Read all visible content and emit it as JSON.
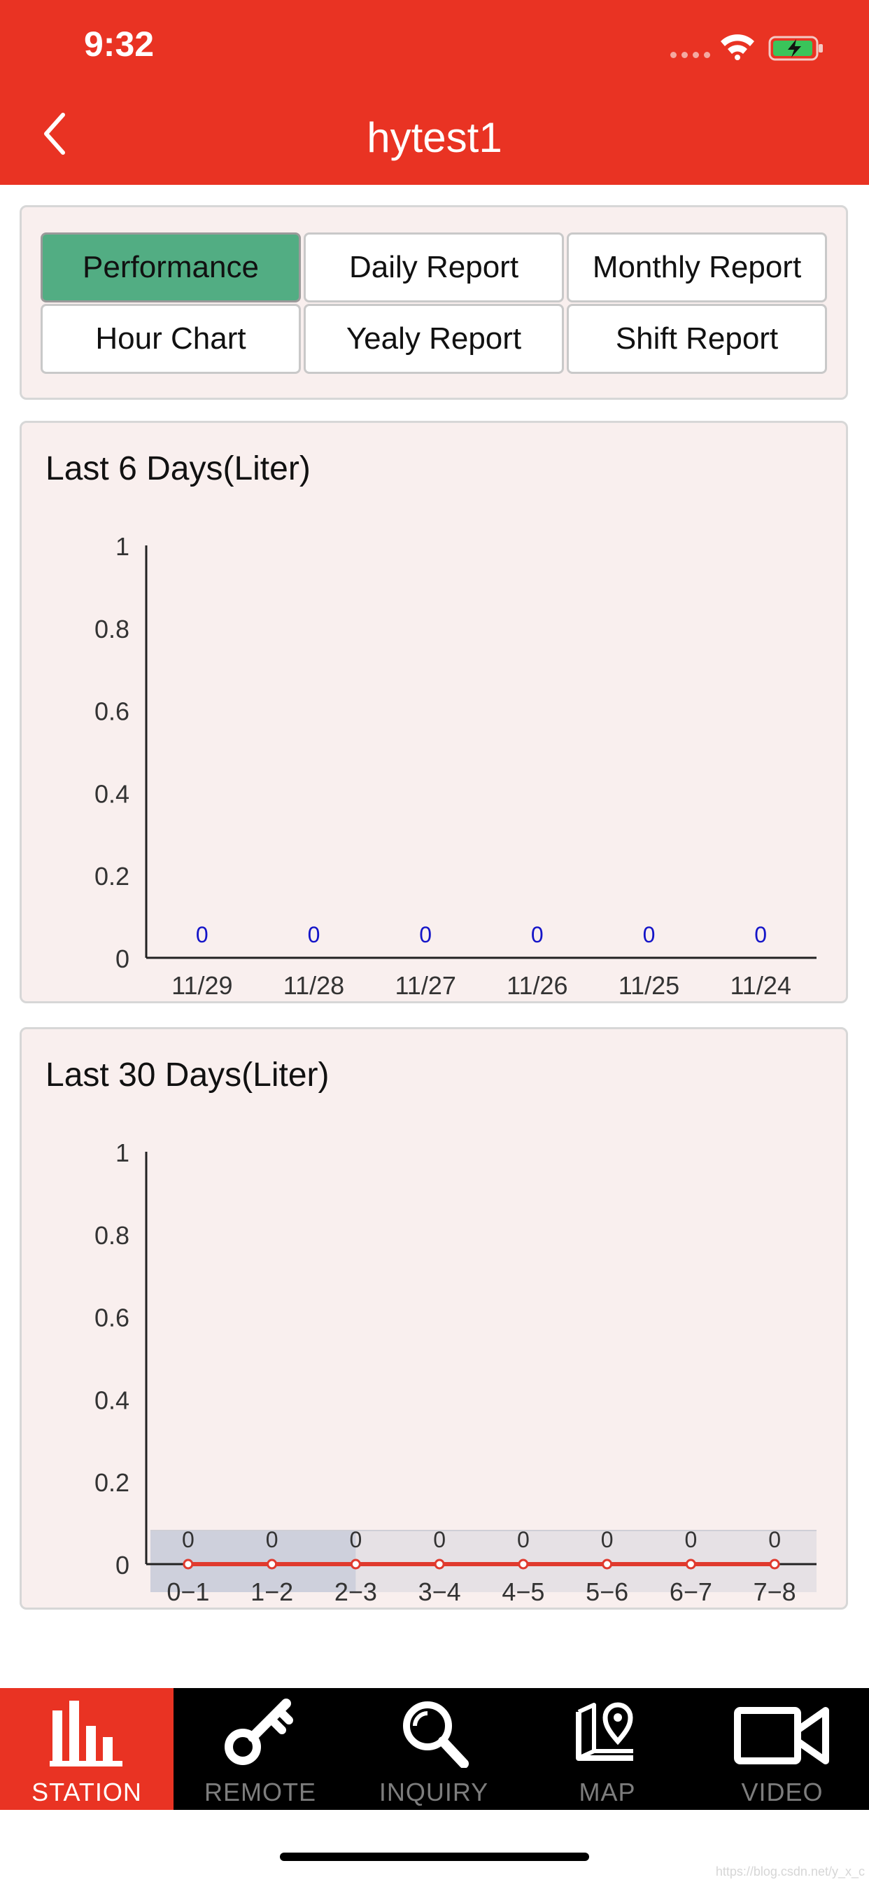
{
  "status_bar": {
    "time": "9:32"
  },
  "header": {
    "title": "hytest1"
  },
  "tabs": [
    {
      "label": "Performance",
      "active": true
    },
    {
      "label": "Daily Report",
      "active": false
    },
    {
      "label": "Monthly Report",
      "active": false
    },
    {
      "label": "Hour Chart",
      "active": false
    },
    {
      "label": "Yealy Report",
      "active": false
    },
    {
      "label": "Shift Report",
      "active": false
    }
  ],
  "chart_data": [
    {
      "type": "bar",
      "title": "Last 6 Days(Liter)",
      "categories": [
        "11/29",
        "11/28",
        "11/27",
        "11/26",
        "11/25",
        "11/24"
      ],
      "values": [
        0,
        0,
        0,
        0,
        0,
        0
      ],
      "value_labels": [
        "0",
        "0",
        "0",
        "0",
        "0",
        "0"
      ],
      "y_ticks": [
        "0",
        "0.2",
        "0.4",
        "0.6",
        "0.8",
        "1"
      ],
      "ylim": [
        0,
        1
      ],
      "grid": false,
      "label_color": "#1414c8"
    },
    {
      "type": "line",
      "title": "Last 30 Days(Liter)",
      "categories": [
        "0−1",
        "1−2",
        "2−3",
        "3−4",
        "4−5",
        "5−6",
        "6−7",
        "7−8"
      ],
      "values": [
        0,
        0,
        0,
        0,
        0,
        0,
        0,
        0
      ],
      "value_labels": [
        "0",
        "0",
        "0",
        "0",
        "0",
        "0",
        "0",
        "0"
      ],
      "y_ticks": [
        "0",
        "0.2",
        "0.4",
        "0.6",
        "0.8",
        "1"
      ],
      "ylim": [
        0,
        1
      ],
      "grid": false,
      "line_color": "#e03a2e",
      "zoom_selection": [
        "0−1",
        "2−3"
      ]
    }
  ],
  "bottom_nav": [
    {
      "label": "STATION",
      "icon": "bar-chart-icon",
      "active": true
    },
    {
      "label": "REMOTE",
      "icon": "key-icon",
      "active": false
    },
    {
      "label": "INQUIRY",
      "icon": "search-icon",
      "active": false
    },
    {
      "label": "MAP",
      "icon": "map-pin-icon",
      "active": false
    },
    {
      "label": "VIDEO",
      "icon": "video-camera-icon",
      "active": false
    }
  ],
  "watermark": "https://blog.csdn.net/y_x_c",
  "colors": {
    "accent": "#e93323",
    "active_tab": "#52ad83",
    "card_bg": "#f9efee"
  }
}
